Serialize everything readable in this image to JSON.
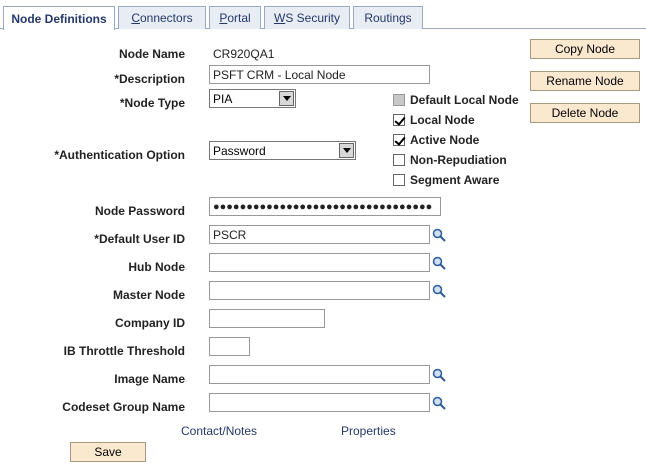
{
  "tabs": [
    {
      "label": "Node Definitions",
      "active": true
    },
    {
      "label": "Connectors",
      "u": "C",
      "rest": "onnectors"
    },
    {
      "label": "Portal",
      "u": "P",
      "rest": "ortal"
    },
    {
      "label": "WS Security",
      "u": "W",
      "rest": "S Security"
    },
    {
      "label": "Routings"
    }
  ],
  "form": {
    "node_name_label": "Node Name",
    "node_name_value": "CR920QA1",
    "description_label": "*Description",
    "description_value": "PSFT CRM - Local Node",
    "node_type_label": "*Node Type",
    "node_type_value": "PIA",
    "auth_label": "*Authentication Option",
    "auth_value": "Password",
    "password_label": "Node Password",
    "password_value": "●●●●●●●●●●●●●●●●●●●●●●●●●●●●●●●●●",
    "default_user_label": "*Default User ID",
    "default_user_value": "PSCR",
    "hub_node_label": "Hub Node",
    "hub_node_value": "",
    "master_node_label": "Master Node",
    "master_node_value": "",
    "company_id_label": "Company ID",
    "company_id_value": "",
    "ib_throttle_label": "IB Throttle Threshold",
    "ib_throttle_value": "",
    "image_name_label": "Image Name",
    "image_name_value": "",
    "codeset_label": "Codeset Group Name",
    "codeset_value": ""
  },
  "checkboxes": [
    {
      "label": "Default Local Node",
      "checked": false,
      "disabled": true
    },
    {
      "label": "Local Node",
      "checked": true,
      "disabled": false
    },
    {
      "label": "Active Node",
      "checked": true,
      "disabled": false
    },
    {
      "label": "Non-Repudiation",
      "checked": false,
      "disabled": false
    },
    {
      "label": "Segment Aware",
      "checked": false,
      "disabled": false
    }
  ],
  "buttons": {
    "copy": "Copy Node",
    "rename": "Rename Node",
    "delete": "Delete Node",
    "save": "Save"
  },
  "links": {
    "contact_notes": "Contact/Notes",
    "properties": "Properties"
  },
  "colors": {
    "tab_border": "#9aa9c6",
    "tab_text": "#24386b",
    "button_bg": "#fbe9cf",
    "link": "#24386b"
  }
}
